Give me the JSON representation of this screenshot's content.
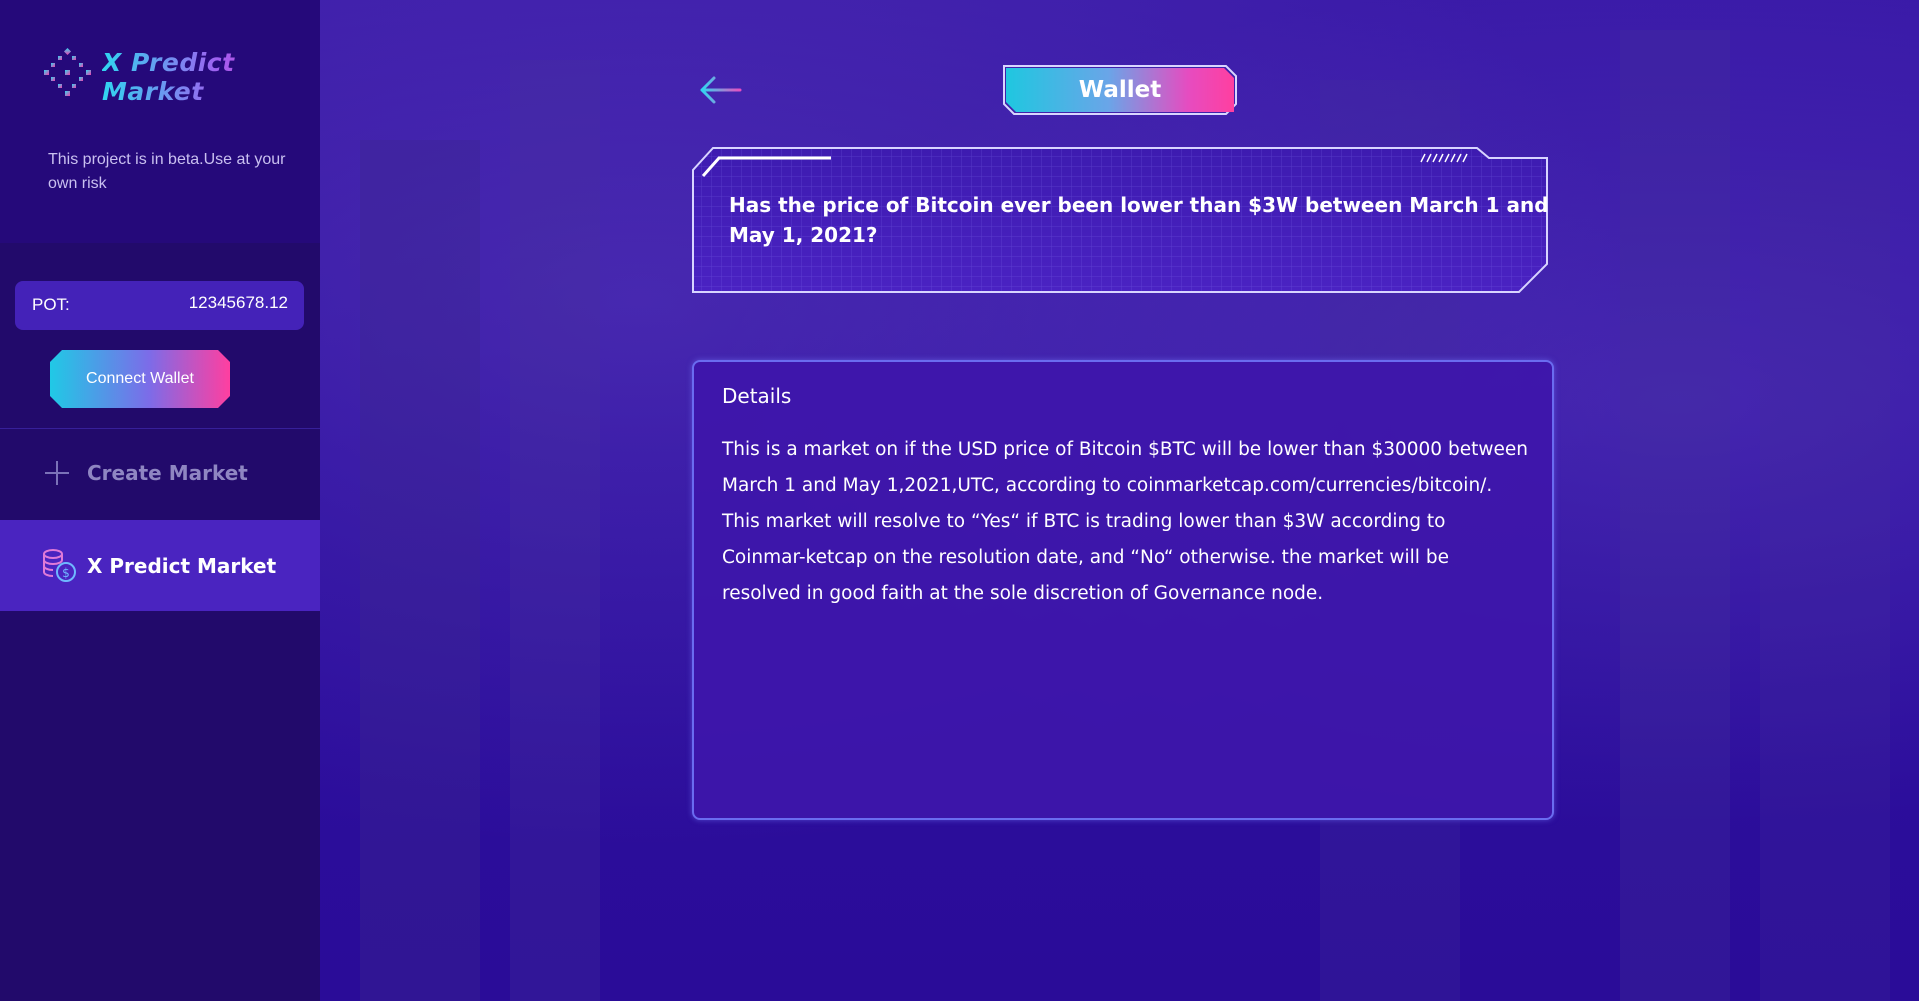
{
  "app": {
    "brand_name": "X Predict Market",
    "beta_note": "This project is in beta.Use at your own risk"
  },
  "sidebar": {
    "pot_label": "POT:",
    "pot_value": "12345678.12",
    "connect_wallet_label": "Connect Wallet",
    "nav": [
      {
        "label": "Create Market",
        "icon": "plus-icon"
      },
      {
        "label": "X Predict Market",
        "icon": "coins-dollar-icon",
        "active": true
      }
    ]
  },
  "header": {
    "back_icon": "arrow-left-icon",
    "wallet_label": "Wallet"
  },
  "market": {
    "question": "Has the price of Bitcoin ever been lower than $3W between March 1 and May 1, 2021?",
    "details_title": "Details",
    "details_body": "This is a market on if the USD price of Bitcoin $BTC will be lower than $30000 between March 1 and May 1,2021,UTC, according to coinmarketcap.com/currencies/bitcoin/. This market will resolve to “Yes“ if BTC is trading lower than $3W according to Coinmar-ketcap on the resolution date, and “No“ otherwise. the market will be resolved in good faith at the sole discretion of Governance node."
  },
  "colors": {
    "sidebar_bg": "#220a6b",
    "main_bg": "#2e0fa0",
    "accent_cyan": "#20c9e6",
    "accent_pink": "#ff3fa0",
    "active_nav_bg": "#4a24c0",
    "pot_bg": "#4422b8"
  }
}
